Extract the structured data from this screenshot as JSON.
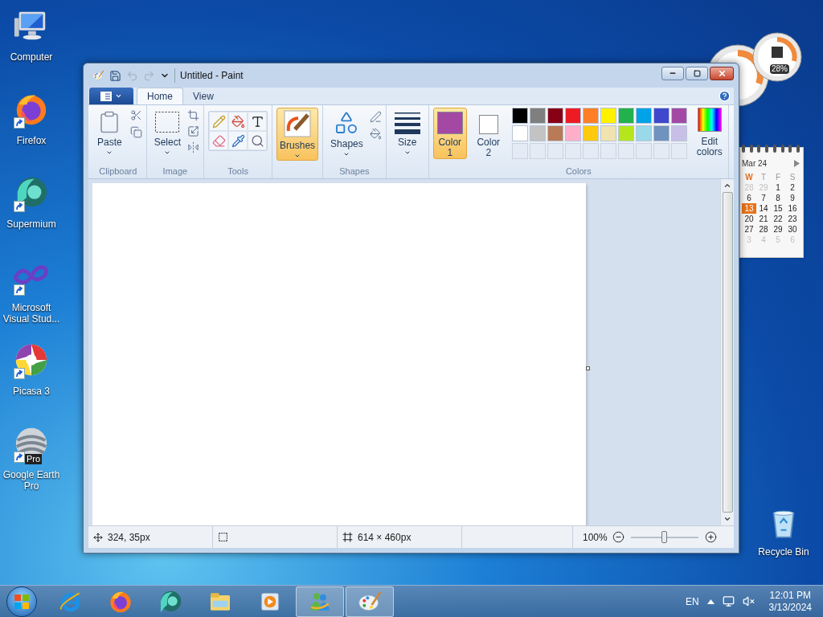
{
  "desktop_icons": [
    {
      "label": "Computer",
      "kind": "computer",
      "shortcut": false
    },
    {
      "label": "Firefox",
      "kind": "firefox",
      "shortcut": true
    },
    {
      "label": "Supermium",
      "kind": "supermium",
      "shortcut": true
    },
    {
      "label": "Microsoft Visual Stud...",
      "kind": "visual_studio",
      "shortcut": true
    },
    {
      "label": "Picasa 3",
      "kind": "picasa",
      "shortcut": true
    },
    {
      "label": "Google Earth Pro",
      "kind": "google_earth",
      "shortcut": true,
      "badge": "Pro"
    }
  ],
  "recycle_bin": {
    "label": "Recycle Bin"
  },
  "cpu_meter": {
    "reading": "28%"
  },
  "calendar": {
    "month": "Mar 24",
    "weekdays": [
      {
        "label": "W",
        "today": true
      },
      {
        "label": "T",
        "today": false
      },
      {
        "label": "F",
        "today": false
      },
      {
        "label": "S",
        "today": false
      }
    ],
    "weeks": [
      [
        {
          "day": "28",
          "muted": true,
          "today": false
        },
        {
          "day": "29",
          "muted": true,
          "today": false
        },
        {
          "day": "1",
          "muted": false,
          "today": false
        },
        {
          "day": "2",
          "muted": false,
          "today": false
        }
      ],
      [
        {
          "day": "6",
          "muted": false,
          "today": false
        },
        {
          "day": "7",
          "muted": false,
          "today": false
        },
        {
          "day": "8",
          "muted": false,
          "today": false
        },
        {
          "day": "9",
          "muted": false,
          "today": false
        }
      ],
      [
        {
          "day": "13",
          "muted": false,
          "today": true
        },
        {
          "day": "14",
          "muted": false,
          "today": false
        },
        {
          "day": "15",
          "muted": false,
          "today": false
        },
        {
          "day": "16",
          "muted": false,
          "today": false
        }
      ],
      [
        {
          "day": "20",
          "muted": false,
          "today": false
        },
        {
          "day": "21",
          "muted": false,
          "today": false
        },
        {
          "day": "22",
          "muted": false,
          "today": false
        },
        {
          "day": "23",
          "muted": false,
          "today": false
        }
      ],
      [
        {
          "day": "27",
          "muted": false,
          "today": false
        },
        {
          "day": "28",
          "muted": false,
          "today": false
        },
        {
          "day": "29",
          "muted": false,
          "today": false
        },
        {
          "day": "30",
          "muted": false,
          "today": false
        }
      ],
      [
        {
          "day": "3",
          "muted": true,
          "today": false
        },
        {
          "day": "4",
          "muted": true,
          "today": false
        },
        {
          "day": "5",
          "muted": true,
          "today": false
        },
        {
          "day": "6",
          "muted": true,
          "today": false
        }
      ]
    ]
  },
  "window": {
    "title": "Untitled - Paint",
    "tabs": [
      {
        "label": "Home",
        "selected": true
      },
      {
        "label": "View",
        "selected": false
      }
    ],
    "groups": [
      {
        "kind": "clipboard",
        "label": "Clipboard",
        "button": "Paste"
      },
      {
        "kind": "image",
        "label": "Image",
        "button": "Select"
      },
      {
        "kind": "tools",
        "label": "Tools"
      },
      {
        "kind": "brushes",
        "button": "Brushes",
        "selected": true
      },
      {
        "kind": "shapes",
        "label": "Shapes",
        "button": "Shapes"
      },
      {
        "kind": "size",
        "button": "Size"
      },
      {
        "kind": "colors",
        "label": "Colors",
        "edit_button": "Edit colors",
        "color_slots": [
          {
            "label": "Color 1",
            "color": "#a349a4",
            "selected": true
          },
          {
            "label": "Color 2",
            "color": "#ffffff",
            "selected": false
          }
        ],
        "palette": [
          {
            "color": "#000000"
          },
          {
            "color": "#7f7f7f"
          },
          {
            "color": "#880015"
          },
          {
            "color": "#ed1c24"
          },
          {
            "color": "#ff7f27"
          },
          {
            "color": "#fff200"
          },
          {
            "color": "#22b14c"
          },
          {
            "color": "#00a2e8"
          },
          {
            "color": "#3f48cc"
          },
          {
            "color": "#a349a4"
          },
          {
            "color": "#ffffff"
          },
          {
            "color": "#c3c3c3"
          },
          {
            "color": "#b97a57"
          },
          {
            "color": "#ffaec9"
          },
          {
            "color": "#ffc90e"
          },
          {
            "color": "#efe4b0"
          },
          {
            "color": "#b5e61d"
          },
          {
            "color": "#99d9ea"
          },
          {
            "color": "#7092be"
          },
          {
            "color": "#c8bfe7"
          }
        ]
      }
    ],
    "status_bar": {
      "cursor": "324, 35px",
      "size": "614 × 460px",
      "zoom": "100%",
      "zoom_slider": {
        "level": 0.5
      }
    }
  },
  "taskbar": {
    "apps": [
      {
        "kind": "ie",
        "running": false
      },
      {
        "kind": "firefox",
        "running": false
      },
      {
        "kind": "supermium",
        "running": false
      },
      {
        "kind": "explorer",
        "running": false
      },
      {
        "kind": "media",
        "running": false
      },
      {
        "kind": "messenger",
        "running": true
      },
      {
        "kind": "paint",
        "running": true
      }
    ],
    "language": "EN",
    "time": "12:01 PM",
    "date": "3/13/2024"
  }
}
